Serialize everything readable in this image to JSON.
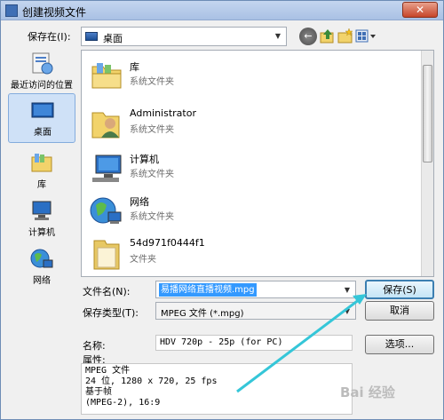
{
  "window": {
    "title": "创建视频文件",
    "close_label": "✕"
  },
  "toolbar": {
    "save_in_label": "保存在(I):",
    "save_in_value": "桌面",
    "back_icon": "back-icon",
    "up_icon": "up-folder-icon",
    "new_folder_icon": "new-folder-icon",
    "view_icon": "view-menu-icon"
  },
  "places": [
    {
      "label": "最近访问的位置",
      "icon": "recent-places-icon"
    },
    {
      "label": "桌面",
      "icon": "desktop-icon",
      "selected": true
    },
    {
      "label": "库",
      "icon": "libraries-icon"
    },
    {
      "label": "计算机",
      "icon": "computer-icon"
    },
    {
      "label": "网络",
      "icon": "network-icon"
    }
  ],
  "files": [
    {
      "name": "库",
      "type": "系统文件夹",
      "icon": "libraries-folder-icon"
    },
    {
      "name": "Administrator",
      "type": "系统文件夹",
      "icon": "user-folder-icon"
    },
    {
      "name": "计算机",
      "type": "系统文件夹",
      "icon": "computer-icon"
    },
    {
      "name": "网络",
      "type": "系统文件夹",
      "icon": "network-icon"
    },
    {
      "name": "54d971f0444f1",
      "type": "文件夹",
      "icon": "folder-icon"
    }
  ],
  "form": {
    "filename_label": "文件名(N):",
    "filename_value": "易播网络直播视频.mpg",
    "filetype_label": "保存类型(T):",
    "filetype_value": "MPEG 文件 (*.mpg)",
    "save_label": "保存(S)",
    "cancel_label": "取消",
    "options_label": "选项...",
    "name_label": "名称:",
    "name_value": "HDV 720p - 25p  (for PC)",
    "attr_label": "属性:",
    "attr_lines": [
      "MPEG 文件",
      "24 位, 1280 x 720, 25 fps",
      "基于帧",
      "(MPEG-2), 16:9"
    ]
  },
  "watermark": "Bai 经验"
}
